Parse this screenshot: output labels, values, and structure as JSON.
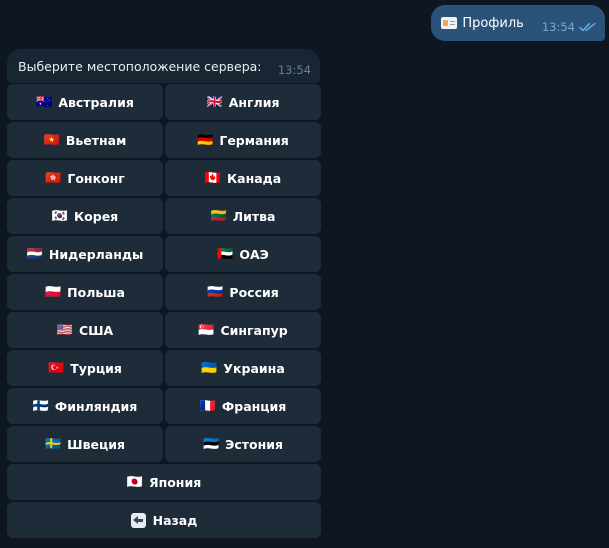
{
  "outgoing_message": {
    "icon": "id-card-icon",
    "text": "Профиль",
    "time": "13:54"
  },
  "incoming_message": {
    "text": "Выберите местоположение сервера:",
    "time": "13:54"
  },
  "keyboard": {
    "rows": [
      [
        {
          "flag": "🇦🇺",
          "label": "Австралия"
        },
        {
          "flag": "🇬🇧",
          "label": "Англия"
        }
      ],
      [
        {
          "flag": "🇻🇳",
          "label": "Вьетнам"
        },
        {
          "flag": "🇩🇪",
          "label": "Германия"
        }
      ],
      [
        {
          "flag": "🇭🇰",
          "label": "Гонконг"
        },
        {
          "flag": "🇨🇦",
          "label": "Канада"
        }
      ],
      [
        {
          "flag": "🇰🇷",
          "label": "Корея"
        },
        {
          "flag": "🇱🇹",
          "label": "Литва"
        }
      ],
      [
        {
          "flag": "🇳🇱",
          "label": "Нидерланды"
        },
        {
          "flag": "🇦🇪",
          "label": "ОАЭ"
        }
      ],
      [
        {
          "flag": "🇵🇱",
          "label": "Польша"
        },
        {
          "flag": "🇷🇺",
          "label": "Россия"
        }
      ],
      [
        {
          "flag": "🇺🇸",
          "label": "США"
        },
        {
          "flag": "🇸🇬",
          "label": "Сингапур"
        }
      ],
      [
        {
          "flag": "🇹🇷",
          "label": "Турция"
        },
        {
          "flag": "🇺🇦",
          "label": "Украина"
        }
      ],
      [
        {
          "flag": "🇫🇮",
          "label": "Финляндия"
        },
        {
          "flag": "🇫🇷",
          "label": "Франция"
        }
      ],
      [
        {
          "flag": "🇸🇪",
          "label": "Швеция"
        },
        {
          "flag": "🇪🇪",
          "label": "Эстония"
        }
      ],
      [
        {
          "flag": "🇯🇵",
          "label": "Япония"
        }
      ]
    ],
    "back": {
      "icon": "back-arrow-icon",
      "label": "Назад"
    }
  },
  "colors": {
    "background": "#0e1621",
    "outgoing_bubble": "#2b5278",
    "incoming_bubble": "#182533",
    "button": "#1e2c3a",
    "read_checks": "#6ab3f3"
  }
}
